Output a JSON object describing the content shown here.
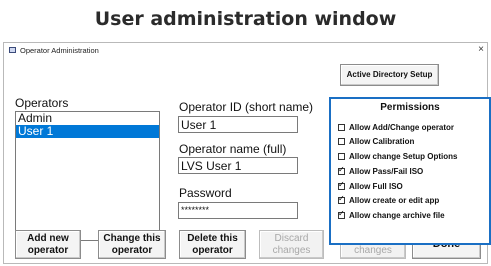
{
  "heading": "User administration window",
  "window": {
    "title": "Operator Administration",
    "close_glyph": "×"
  },
  "active_directory_button": "Active Directory Setup",
  "operators": {
    "label": "Operators",
    "items": [
      {
        "name": "Admin",
        "selected": false
      },
      {
        "name": "User 1",
        "selected": true
      }
    ]
  },
  "operator_id": {
    "label": "Operator ID (short name)",
    "value": "User 1"
  },
  "operator_name": {
    "label": "Operator name (full)",
    "value": "LVS User 1"
  },
  "password": {
    "label": "Password",
    "value": "********"
  },
  "permissions": {
    "title": "Permissions",
    "items": [
      {
        "label": "Allow Add/Change operator",
        "checked": false
      },
      {
        "label": "Allow Calibration",
        "checked": false
      },
      {
        "label": "Allow change Setup Options",
        "checked": false
      },
      {
        "label": "Allow Pass/Fail ISO",
        "checked": true
      },
      {
        "label": "Allow Full ISO",
        "checked": true
      },
      {
        "label": "Allow create or edit app",
        "checked": true
      },
      {
        "label": "Allow change archive file",
        "checked": true
      }
    ]
  },
  "buttons": {
    "add_new_operator": {
      "line1": "Add new",
      "line2": "operator"
    },
    "change_operator": {
      "line1": "Change this",
      "line2": "operator"
    },
    "delete_operator": {
      "line1": "Delete this",
      "line2": "operator"
    },
    "discard_changes": {
      "line1": "Discard",
      "line2": "changes"
    },
    "save_changes": "Save changes",
    "done": "Done"
  }
}
